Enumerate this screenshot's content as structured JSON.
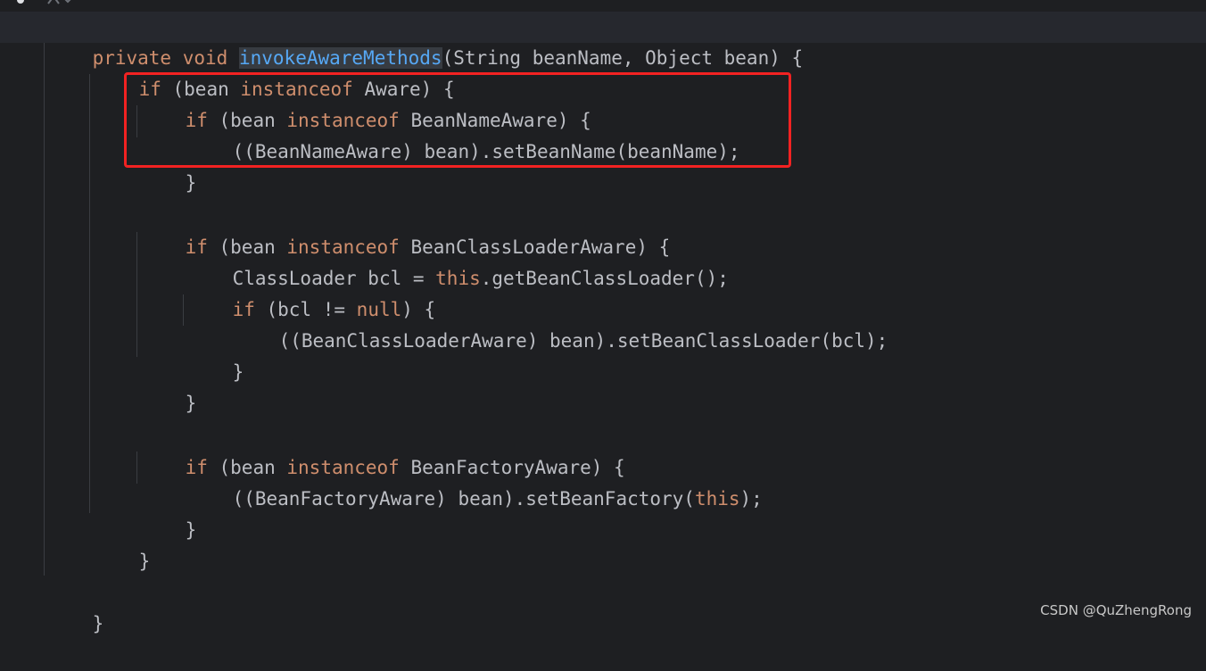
{
  "code": {
    "method_signature": {
      "kw_private": "private",
      "kw_void": "void",
      "method_name": "invokeAwareMethods",
      "params": "(String beanName, Object bean) {"
    },
    "line_aware": {
      "kw_if": "if",
      "a": " (bean ",
      "kw_instanceof": "instanceof",
      "b": " Aware) {"
    },
    "line_bna_if": {
      "kw_if": "if",
      "a": " (bean ",
      "kw_instanceof": "instanceof",
      "b": " BeanNameAware) {"
    },
    "line_bna_call": "((BeanNameAware) bean).setBeanName(beanName);",
    "close_brace": "}",
    "line_bcla_if": {
      "kw_if": "if",
      "a": " (bean ",
      "kw_instanceof": "instanceof",
      "b": " BeanClassLoaderAware) {"
    },
    "line_bcl_decl": {
      "a": "ClassLoader bcl = ",
      "kw_this": "this",
      "b": ".getBeanClassLoader();"
    },
    "line_bcl_if": {
      "kw_if": "if",
      "a": " (bcl != ",
      "kw_null": "null",
      "b": ") {"
    },
    "line_bcla_call": "((BeanClassLoaderAware) bean).setBeanClassLoader(bcl);",
    "line_bfa_if": {
      "kw_if": "if",
      "a": " (bean ",
      "kw_instanceof": "instanceof",
      "b": " BeanFactoryAware) {"
    },
    "line_bfa_call": {
      "a": "((BeanFactoryAware) bean).setBeanFactory(",
      "kw_this": "this",
      "b": ");"
    }
  },
  "colors": {
    "background": "#1e1f22",
    "text": "#bcbec4",
    "keyword": "#cf8e6d",
    "method_declaration": "#56a8f5",
    "highlight_box": "#f22222"
  },
  "watermark": "CSDN @QuZhengRong"
}
